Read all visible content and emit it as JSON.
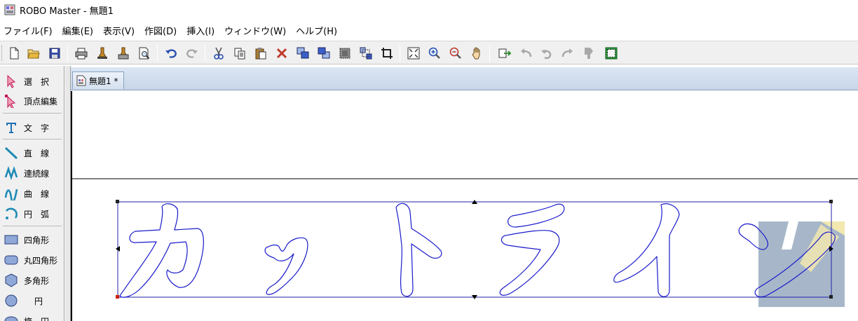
{
  "window": {
    "title": "ROBO Master - 無題1"
  },
  "menu": {
    "items": [
      {
        "label": "ファイル(F)"
      },
      {
        "label": "編集(E)"
      },
      {
        "label": "表示(V)"
      },
      {
        "label": "作図(D)"
      },
      {
        "label": "挿入(I)"
      },
      {
        "label": "ウィンドウ(W)"
      },
      {
        "label": "ヘルプ(H)"
      }
    ]
  },
  "toolbar": {
    "buttons": [
      {
        "icon": "new-document-icon",
        "enabled": true
      },
      {
        "icon": "open-folder-icon",
        "enabled": true
      },
      {
        "icon": "save-icon",
        "enabled": true
      },
      {
        "icon": "print-icon",
        "enabled": true
      },
      {
        "icon": "cut-settings-icon",
        "enabled": true
      },
      {
        "icon": "plotter-output-icon",
        "enabled": true
      },
      {
        "icon": "print-preview-icon",
        "enabled": true
      },
      {
        "icon": "undo-icon",
        "enabled": true
      },
      {
        "icon": "redo-icon",
        "enabled": false
      },
      {
        "icon": "cut-icon",
        "enabled": true
      },
      {
        "icon": "copy-icon",
        "enabled": true
      },
      {
        "icon": "paste-icon",
        "enabled": true
      },
      {
        "icon": "delete-icon",
        "enabled": true
      },
      {
        "icon": "bring-front-icon",
        "enabled": true
      },
      {
        "icon": "send-back-icon",
        "enabled": true
      },
      {
        "icon": "group-icon",
        "enabled": true
      },
      {
        "icon": "ungroup-icon",
        "enabled": true
      },
      {
        "icon": "crop-icon",
        "enabled": true
      },
      {
        "icon": "zoom-fit-icon",
        "enabled": true
      },
      {
        "icon": "zoom-in-icon",
        "enabled": true
      },
      {
        "icon": "zoom-out-icon",
        "enabled": true
      },
      {
        "icon": "pan-hand-icon",
        "enabled": true
      },
      {
        "icon": "transform-icon",
        "enabled": true
      },
      {
        "icon": "rotate-left-icon",
        "enabled": false
      },
      {
        "icon": "rotate-ccw-icon",
        "enabled": false
      },
      {
        "icon": "rotate-right-icon",
        "enabled": false
      },
      {
        "icon": "flip-icon",
        "enabled": false
      },
      {
        "icon": "selection-frame-icon",
        "enabled": true
      }
    ]
  },
  "tools": [
    {
      "label": "選　択",
      "icon": "select-arrow-icon"
    },
    {
      "label": "頂点編集",
      "icon": "vertex-edit-icon"
    },
    {
      "label": "文　字",
      "icon": "text-tool-icon"
    },
    {
      "label": "直　線",
      "icon": "line-tool-icon"
    },
    {
      "label": "連続線",
      "icon": "polyline-tool-icon"
    },
    {
      "label": "曲　線",
      "icon": "curve-tool-icon"
    },
    {
      "label": "円　弧",
      "icon": "arc-tool-icon"
    },
    {
      "label": "四角形",
      "icon": "rectangle-tool-icon"
    },
    {
      "label": "丸四角形",
      "icon": "rounded-rectangle-tool-icon"
    },
    {
      "label": "多角形",
      "icon": "polygon-tool-icon"
    },
    {
      "label": "円",
      "icon": "circle-tool-icon"
    },
    {
      "label": "楕　円",
      "icon": "ellipse-tool-icon"
    }
  ],
  "document": {
    "tab_label": "無題1 *",
    "colors": {
      "outline": "#1a1acc",
      "selection": "#2222aa",
      "page_edge": "#000000",
      "anchor_handle": "#cc2200",
      "watermark": "#a7b7c9",
      "watermark_accent": "#f2e8b0"
    }
  }
}
